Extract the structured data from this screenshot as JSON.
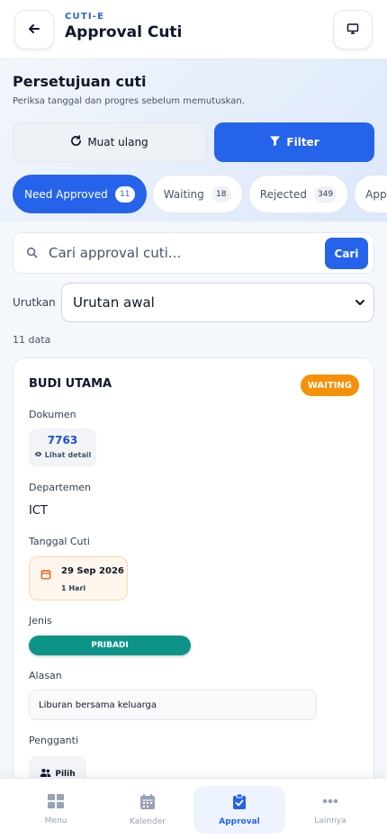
{
  "header": {
    "section": "CUTI-E",
    "title": "Approval Cuti"
  },
  "hero": {
    "heading": "Persetujuan cuti",
    "subtitle": "Periksa tanggal dan progres sebelum memutuskan."
  },
  "actions": {
    "reload_label": "Muat ulang",
    "filter_label": "Filter"
  },
  "tabs": [
    {
      "label": "Need Approved",
      "count": "11",
      "active": true
    },
    {
      "label": "Waiting",
      "count": "18"
    },
    {
      "label": "Rejected",
      "count": "349"
    },
    {
      "label": "Approved",
      "count": ""
    }
  ],
  "search": {
    "placeholder": "Cari approval cuti...",
    "button_label": "Cari"
  },
  "sort": {
    "label": "Urutkan",
    "selected": "Urutan awal"
  },
  "result_count": "11 data",
  "card": {
    "name": "BUDI UTAMA",
    "status": "WAITING",
    "dokumen_label": "Dokumen",
    "doc_number": "7763",
    "doc_link": "Lihat detail",
    "departemen_label": "Departemen",
    "departemen": "ICT",
    "tanggal_label": "Tanggal Cuti",
    "tanggal": "29 Sep 2026",
    "durasi": "1 Hari",
    "jenis_label": "Jenis",
    "jenis": "PRIBADI",
    "alasan_label": "Alasan",
    "alasan": "Liburan bersama keluarga",
    "pengganti_label": "Pengganti",
    "pengganti_button": "Pilih"
  },
  "bottom_nav": [
    {
      "label": "Menu",
      "icon": "grid-icon"
    },
    {
      "label": "Kalender",
      "icon": "calendar-icon"
    },
    {
      "label": "Approval",
      "icon": "clipboard-check-icon",
      "active": true
    },
    {
      "label": "Lainnya",
      "icon": "more-icon"
    }
  ],
  "colors": {
    "accent": "#2563eb",
    "waiting": "#f79009",
    "jenis": "#0d9488"
  }
}
